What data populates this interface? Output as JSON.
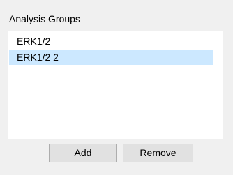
{
  "analysis_groups": {
    "label": "Analysis Groups",
    "items": [
      {
        "label": "ERK1/2",
        "selected": false
      },
      {
        "label": "ERK1/2 2",
        "selected": true
      }
    ],
    "selection_color": "#cce8ff"
  },
  "buttons": {
    "add_label": "Add",
    "remove_label": "Remove"
  }
}
